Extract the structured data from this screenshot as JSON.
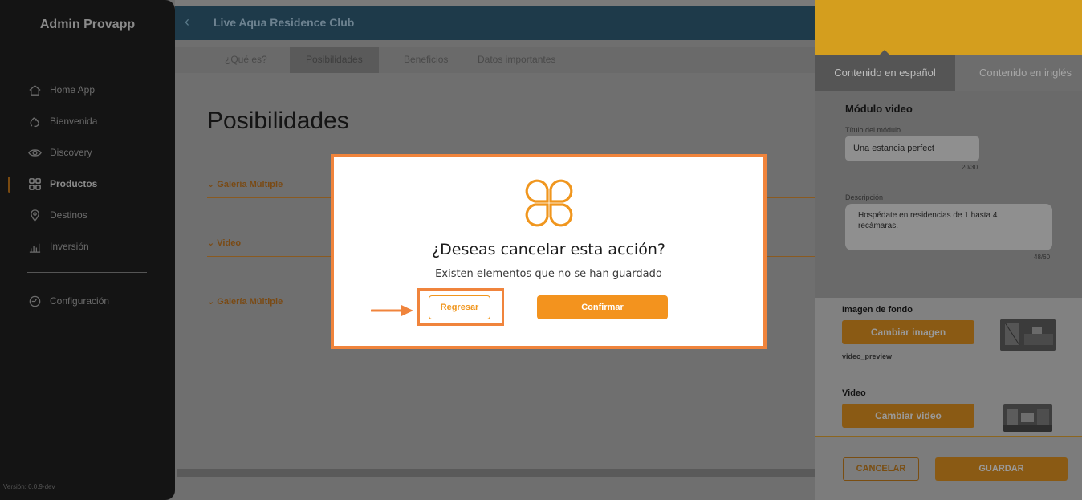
{
  "sidebar": {
    "brand": "Admin Provapp",
    "items": [
      {
        "label": "Home App",
        "icon": "home-icon"
      },
      {
        "label": "Bienvenida",
        "icon": "hand-wave-icon"
      },
      {
        "label": "Discovery",
        "icon": "eye-icon"
      },
      {
        "label": "Productos",
        "icon": "grid-icon",
        "active": true
      },
      {
        "label": "Destinos",
        "icon": "location-pin-icon"
      },
      {
        "label": "Inversión",
        "icon": "bar-chart-icon"
      }
    ],
    "settings": {
      "label": "Configuración",
      "icon": "settings-icon"
    },
    "version": "Versión: 0.0.9-dev"
  },
  "main": {
    "back_icon": "chevron-left-icon",
    "title": "Live Aqua Residence Club",
    "tabs": [
      "¿Qué es?",
      "Posibilidades",
      "Beneficios",
      "Datos importantes"
    ],
    "active_tab": "Posibilidades",
    "page_title": "Posibilidades",
    "accordions": [
      "Galería Múltiple",
      "Video",
      "Galería Múltiple"
    ]
  },
  "panel": {
    "tabs": [
      "Contenido en español",
      "Contenido en inglés"
    ],
    "section_title": "Módulo video",
    "title_label": "Título del módulo",
    "title_value": "Una estancia perfect",
    "title_count": "20/30",
    "desc_label": "Descripción",
    "desc_value": "Hospédate en residencias de 1 hasta 4 recámaras.",
    "desc_count": "48/60",
    "bg_label": "Imagen de fondo",
    "bg_button": "Cambiar imagen",
    "bg_filename": "video_preview",
    "video_label": "Video",
    "video_button": "Cambiar video",
    "cancel": "CANCELAR",
    "save": "GUARDAR"
  },
  "modal": {
    "title": "¿Deseas cancelar esta acción?",
    "subtitle": "Existen elementos que no se han guardado",
    "back_button": "Regresar",
    "confirm_button": "Confirmar"
  },
  "colors": {
    "accent": "#f3931e",
    "annotation": "#f0843c",
    "panel_header": "#d49e1e"
  }
}
